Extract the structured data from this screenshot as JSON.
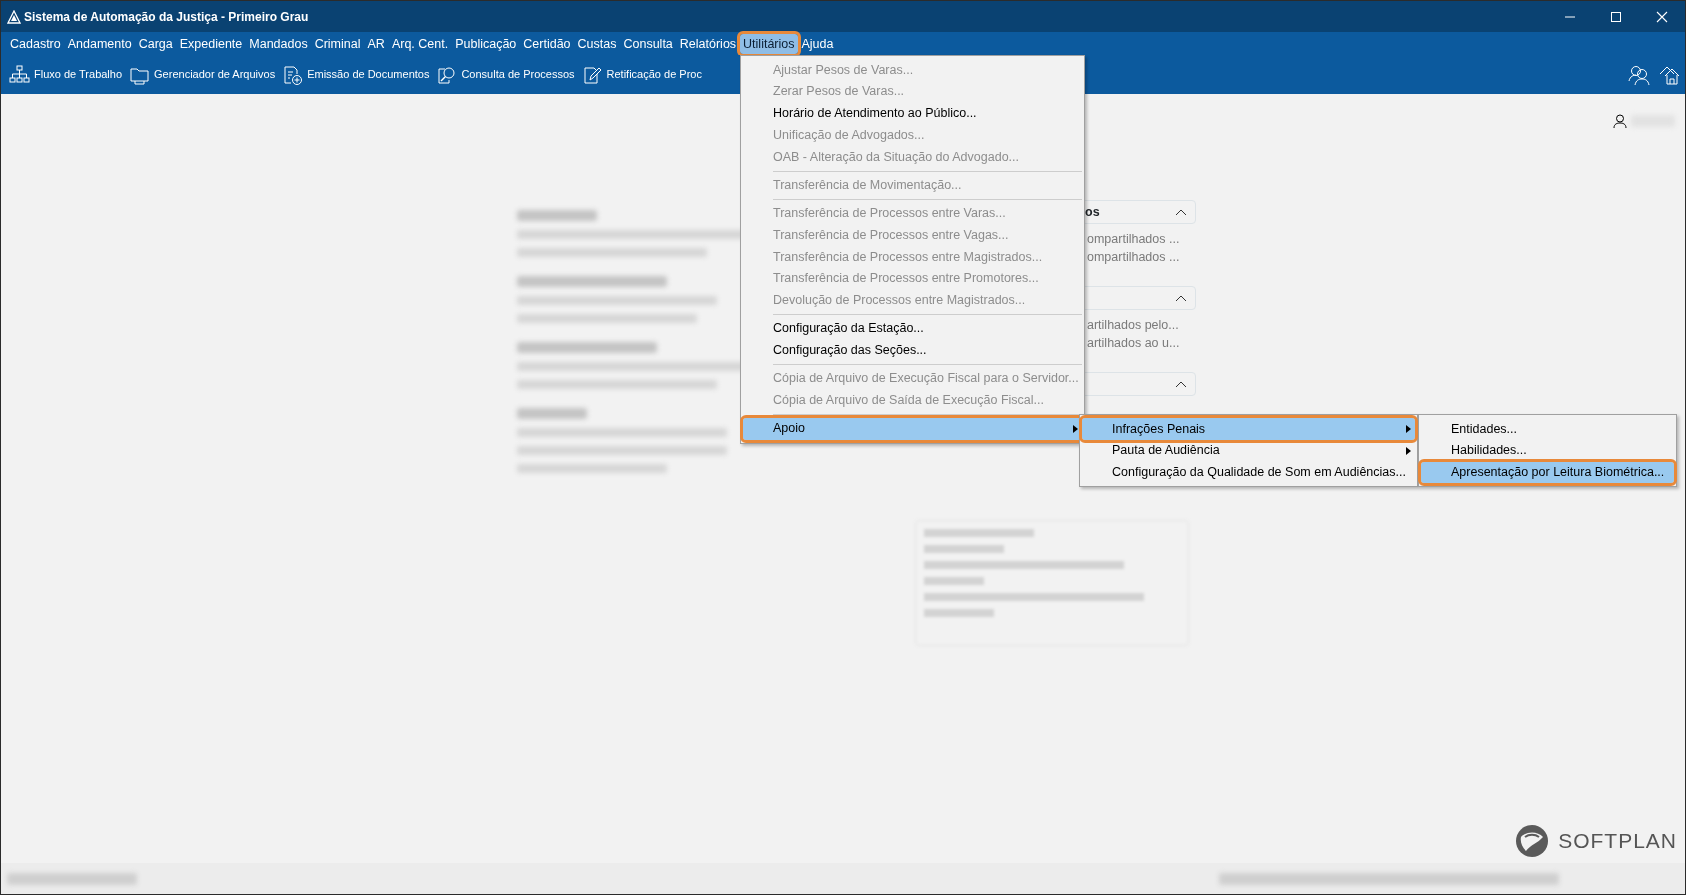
{
  "window": {
    "title": "Sistema de Automação da Justiça - Primeiro Grau"
  },
  "menu_bar": [
    {
      "label": "Cadastro",
      "selected": false
    },
    {
      "label": "Andamento",
      "selected": false
    },
    {
      "label": "Carga",
      "selected": false
    },
    {
      "label": "Expediente",
      "selected": false
    },
    {
      "label": "Mandados",
      "selected": false
    },
    {
      "label": "Criminal",
      "selected": false
    },
    {
      "label": "AR",
      "selected": false
    },
    {
      "label": "Arq. Cent.",
      "selected": false
    },
    {
      "label": "Publicação",
      "selected": false
    },
    {
      "label": "Certidão",
      "selected": false
    },
    {
      "label": "Custas",
      "selected": false
    },
    {
      "label": "Consulta",
      "selected": false
    },
    {
      "label": "Relatórios",
      "selected": false
    },
    {
      "label": "Utilitários",
      "selected": true
    },
    {
      "label": "Ajuda",
      "selected": false
    }
  ],
  "toolbar": [
    {
      "label": "Fluxo de Trabalho",
      "kind": "flow"
    },
    {
      "label": "Gerenciador de Arquivos",
      "kind": "folder"
    },
    {
      "label": "Emissão de Documentos",
      "kind": "document"
    },
    {
      "label": "Consulta de Processos",
      "kind": "search"
    },
    {
      "label": "Retificação de Proc",
      "kind": "edit"
    }
  ],
  "utilities_menu": {
    "items": [
      {
        "kind": "item",
        "label": "Ajustar Pesos de Varas...",
        "disabled": true,
        "selected": false,
        "submenu": false
      },
      {
        "kind": "item",
        "label": "Zerar Pesos de Varas...",
        "disabled": true,
        "selected": false,
        "submenu": false
      },
      {
        "kind": "item",
        "label": "Horário de Atendimento ao Público...",
        "disabled": false,
        "selected": false,
        "submenu": false
      },
      {
        "kind": "item",
        "label": "Unificação de Advogados...",
        "disabled": true,
        "selected": false,
        "submenu": false
      },
      {
        "kind": "item",
        "label": "OAB - Alteração da Situação do Advogado...",
        "disabled": true,
        "selected": false,
        "submenu": false
      },
      {
        "kind": "separator"
      },
      {
        "kind": "item",
        "label": "Transferência de Movimentação...",
        "disabled": true,
        "selected": false,
        "submenu": false
      },
      {
        "kind": "separator"
      },
      {
        "kind": "item",
        "label": "Transferência de Processos entre Varas...",
        "disabled": true,
        "selected": false,
        "submenu": false
      },
      {
        "kind": "item",
        "label": "Transferência de Processos entre Vagas...",
        "disabled": true,
        "selected": false,
        "submenu": false
      },
      {
        "kind": "item",
        "label": "Transferência de Processos entre Magistrados...",
        "disabled": true,
        "selected": false,
        "submenu": false
      },
      {
        "kind": "item",
        "label": "Transferência de Processos entre Promotores...",
        "disabled": true,
        "selected": false,
        "submenu": false
      },
      {
        "kind": "item",
        "label": "Devolução de Processos entre Magistrados...",
        "disabled": true,
        "selected": false,
        "submenu": false
      },
      {
        "kind": "separator"
      },
      {
        "kind": "item",
        "label": "Configuração da Estação...",
        "disabled": false,
        "selected": false,
        "submenu": false
      },
      {
        "kind": "item",
        "label": "Configuração das Seções...",
        "disabled": false,
        "selected": false,
        "submenu": false
      },
      {
        "kind": "separator"
      },
      {
        "kind": "item",
        "label": "Cópia de Arquivo de Execução Fiscal para o Servidor...",
        "disabled": true,
        "selected": false,
        "submenu": false
      },
      {
        "kind": "item",
        "label": "Cópia de Arquivo de Saída de Execução Fiscal...",
        "disabled": true,
        "selected": false,
        "submenu": false
      },
      {
        "kind": "separator"
      },
      {
        "kind": "item",
        "label": "Apoio",
        "disabled": false,
        "selected": true,
        "submenu": true
      }
    ]
  },
  "support_submenu": {
    "items": [
      {
        "label": "Infrações Penais",
        "selected": true,
        "submenu": true
      },
      {
        "label": "Pauta de Audiência",
        "selected": false,
        "submenu": true
      },
      {
        "label": "Configuração da Qualidade de Som em Audiências...",
        "selected": false,
        "submenu": false
      }
    ]
  },
  "penal_submenu": {
    "items": [
      {
        "label": "Entidades...",
        "selected": false
      },
      {
        "label": "Habilidades...",
        "selected": false
      },
      {
        "label": "Apresentação por Leitura Biométrica...",
        "selected": true
      }
    ]
  },
  "panels": [
    {
      "title": "os",
      "expanded": true,
      "lines": [
        "ompartilhados ...",
        "ompartilhados ..."
      ]
    },
    {
      "expanded": true,
      "lines": [
        "artilhados pelo...",
        "artilhados ao u..."
      ]
    },
    {
      "expanded": true
    }
  ],
  "brand": {
    "logo_text": "SOFTPLAN"
  }
}
